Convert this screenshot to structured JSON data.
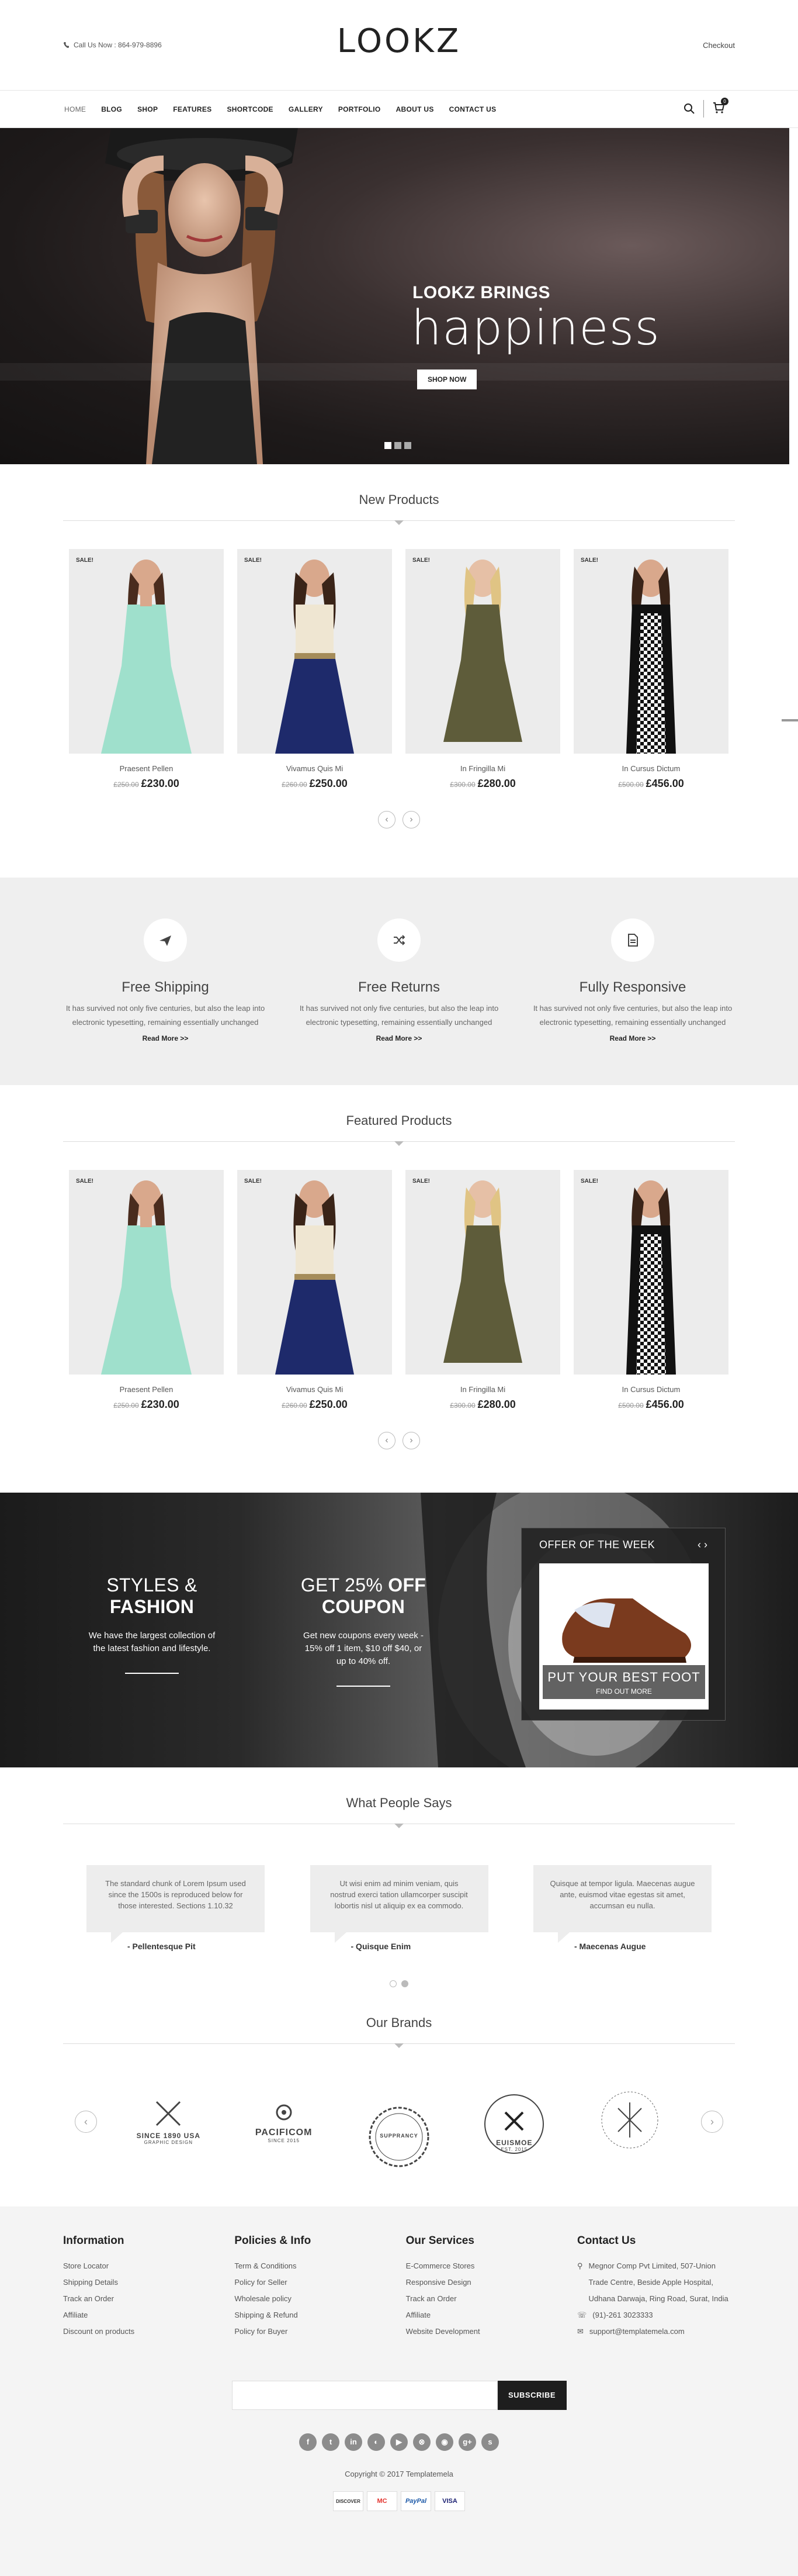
{
  "header": {
    "phone_label": "Call Us Now : 864-979-8896",
    "logo": "LOOKZ",
    "checkout": "Checkout"
  },
  "nav": {
    "items": [
      "HOME",
      "BLOG",
      "SHOP",
      "FEATURES",
      "SHORTCODE",
      "GALLERY",
      "PORTFOLIO",
      "ABOUT US",
      "CONTACT US"
    ],
    "cart_count": "0"
  },
  "hero": {
    "kicker": "LOOKZ BRINGS",
    "headline": "happiness",
    "button": "SHOP NOW"
  },
  "new_products": {
    "title": "New Products",
    "items": [
      {
        "badge": "SALE!",
        "name": "Praesent Pellen",
        "old_price": "£250.00",
        "price": "£230.00"
      },
      {
        "badge": "SALE!",
        "name": "Vivamus Quis Mi",
        "old_price": "£260.00",
        "price": "£250.00"
      },
      {
        "badge": "SALE!",
        "name": "In Fringilla Mi",
        "old_price": "£300.00",
        "price": "£280.00"
      },
      {
        "badge": "SALE!",
        "name": "In Cursus Dictum",
        "old_price": "£500.00",
        "price": "£456.00"
      }
    ]
  },
  "features": {
    "items": [
      {
        "title": "Free Shipping",
        "text": "It has survived not only five centuries, but also the leap into electronic typesetting, remaining essentially unchanged",
        "link": "Read More >>"
      },
      {
        "title": "Free Returns",
        "text": "It has survived not only five centuries, but also the leap into electronic typesetting, remaining essentially unchanged",
        "link": "Read More >>"
      },
      {
        "title": "Fully Responsive",
        "text": "It has survived not only five centuries, but also the leap into electronic typesetting, remaining essentially unchanged",
        "link": "Read More >>"
      }
    ]
  },
  "featured_products": {
    "title": "Featured Products",
    "items": [
      {
        "badge": "SALE!",
        "name": "Praesent Pellen",
        "old_price": "£250.00",
        "price": "£230.00"
      },
      {
        "badge": "SALE!",
        "name": "Vivamus Quis Mi",
        "old_price": "£260.00",
        "price": "£250.00"
      },
      {
        "badge": "SALE!",
        "name": "In Fringilla Mi",
        "old_price": "£300.00",
        "price": "£280.00"
      },
      {
        "badge": "SALE!",
        "name": "In Cursus Dictum",
        "old_price": "£500.00",
        "price": "£456.00"
      }
    ]
  },
  "promo": {
    "left_title_a": "STYLES & ",
    "left_title_b": "FASHION",
    "left_text": "We have the largest collection of the latest fashion and lifestyle.",
    "mid_title_a": "GET 25% ",
    "mid_title_b": "OFF COUPON",
    "mid_text": "Get new coupons every week - 15% off 1 item, $10 off $40, or up to 40% off.",
    "offer_title": "OFFER OF THE WEEK",
    "offer_caption": "PUT YOUR BEST FOOT",
    "offer_link": "FIND OUT MORE"
  },
  "testimonials": {
    "title": "What People Says",
    "items": [
      {
        "text": "The standard chunk of Lorem Ipsum used since the 1500s is reproduced below for those interested. Sections 1.10.32",
        "author": "- Pellentesque Pit"
      },
      {
        "text": "Ut wisi enim ad minim veniam, quis nostrud exerci tation ullamcorper suscipit lobortis nisl ut aliquip ex ea commodo.",
        "author": "- Quisque Enim"
      },
      {
        "text": "Quisque at tempor ligula. Maecenas augue ante, euismod vitae egestas sit amet, accumsan eu nulla.",
        "author": "- Maecenas Augue"
      }
    ]
  },
  "brands": {
    "title": "Our Brands",
    "items": [
      {
        "name": "SINCE 1890 USA",
        "sub": "GRAPHIC DESIGN"
      },
      {
        "name": "PACIFICOM",
        "sub": "SINCE 2015"
      },
      {
        "name": "SUPPRANCY",
        "sub": ""
      },
      {
        "name": "EUISMOE",
        "sub": "EST. 2015"
      },
      {
        "name": "",
        "sub": ""
      }
    ]
  },
  "footer": {
    "cols": [
      {
        "title": "Information",
        "items": [
          "Store Locator",
          "Shipping Details",
          "Track an Order",
          "Affiliate",
          "Discount on products"
        ]
      },
      {
        "title": "Policies & Info",
        "items": [
          "Term & Conditions",
          "Policy for Seller",
          "Wholesale policy",
          "Shipping & Refund",
          "Policy for Buyer"
        ]
      },
      {
        "title": "Our Services",
        "items": [
          "E-Commerce Stores",
          "Responsive Design",
          "Track an Order",
          "Affiliate",
          "Website Development"
        ]
      }
    ],
    "contact": {
      "title": "Contact Us",
      "address": "Megnor Comp Pvt Limited, 507-Union Trade Centre, Beside Apple Hospital, Udhana Darwaja, Ring Road, Surat, India",
      "phone": "(91)-261 3023333",
      "email": "support@templatemela.com"
    },
    "newsletter_button": "SUBSCRIBE",
    "social": [
      "f",
      "t",
      "in",
      "◐",
      "▶",
      "⊗",
      "◉",
      "g+",
      "s"
    ],
    "copyright": "Copyright © 2017 Templatemela",
    "payments": [
      "DISCOVER",
      "MC",
      "PayPal",
      "VISA"
    ]
  }
}
